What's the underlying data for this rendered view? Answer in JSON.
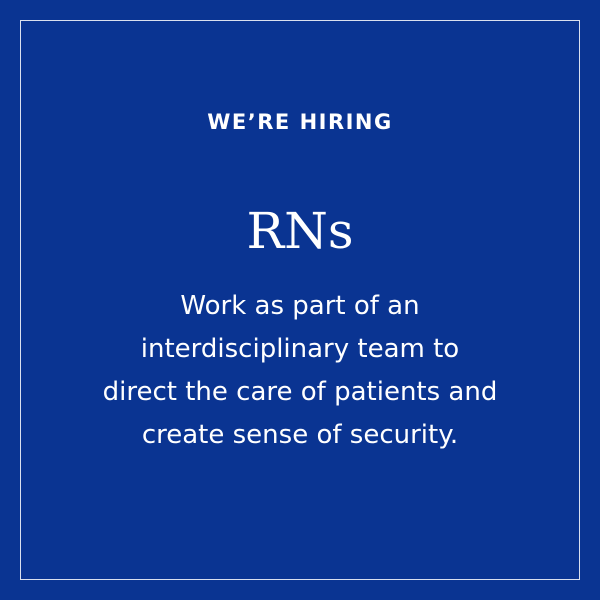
{
  "colors": {
    "background": "#0a3492",
    "text": "#ffffff",
    "frame": "#ffffff"
  },
  "eyebrow": "WE’RE HIRING",
  "headline": "RNs",
  "description_lines": [
    "Work as part of an",
    "interdisciplinary team to",
    "direct the care of patients and",
    "create sense of security."
  ]
}
